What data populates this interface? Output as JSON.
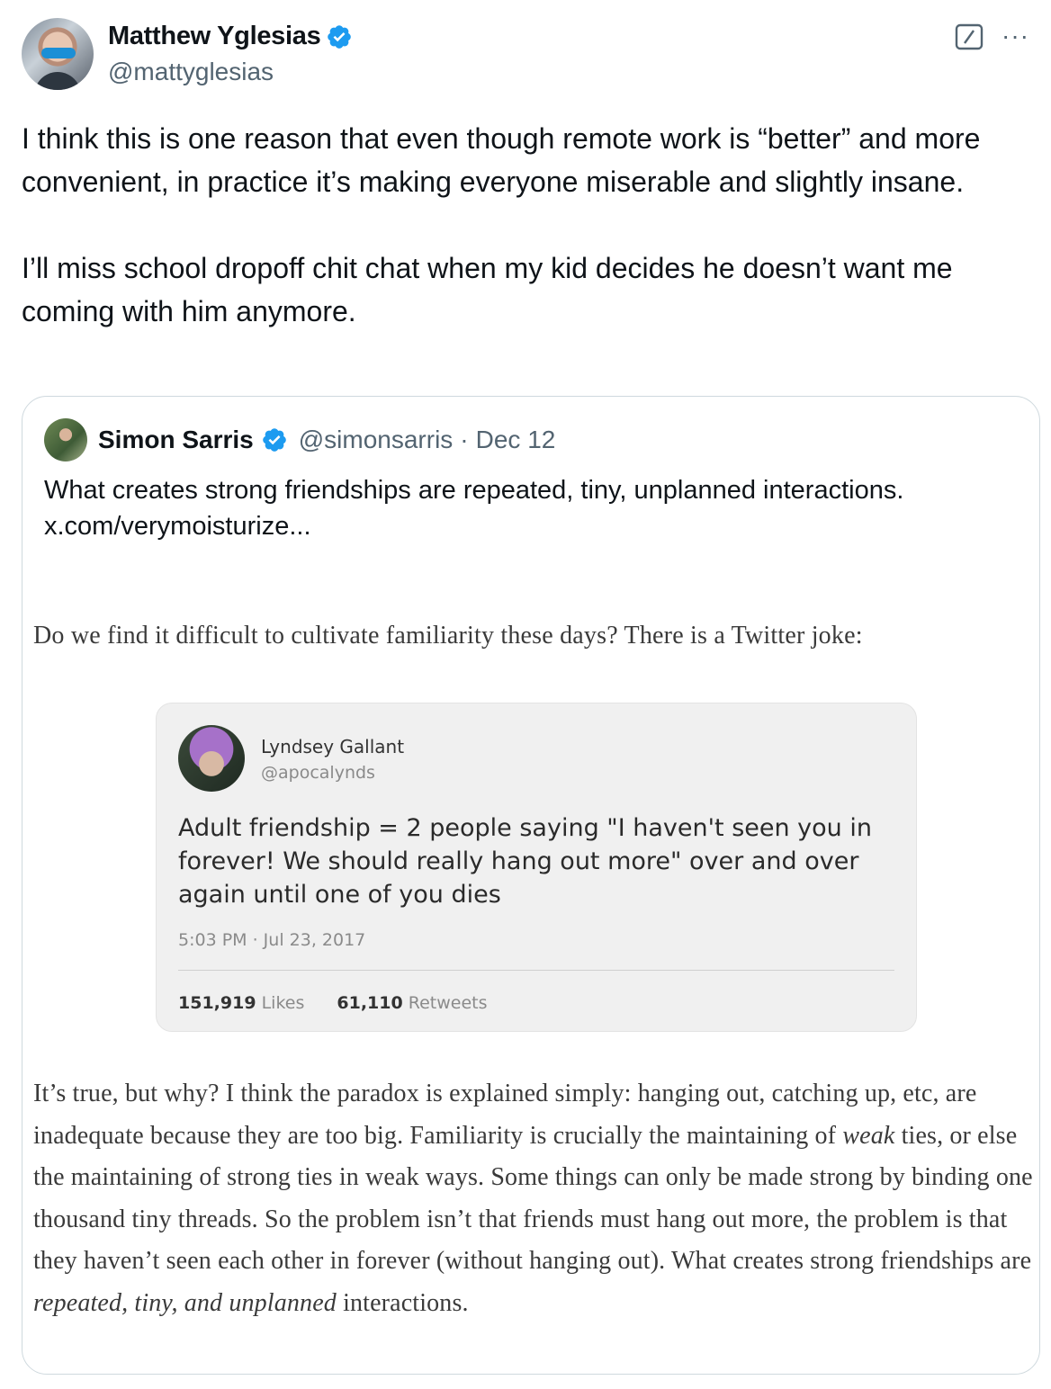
{
  "author": {
    "name": "Matthew Yglesias",
    "handle": "@mattyglesias"
  },
  "tweet": {
    "paragraph1": "I think this is one reason that even though remote work is “better” and more convenient, in practice it’s making everyone miserable and slightly insane.",
    "paragraph2": "I’ll miss school dropoff chit chat when my kid decides he doesn’t want me coming with him anymore."
  },
  "actions": {
    "more": "···"
  },
  "quoted": {
    "name": "Simon Sarris",
    "handle": "@simonsarris",
    "separator": "·",
    "date": "Dec 12",
    "text_line1": "What creates strong friendships are repeated, tiny, unplanned interactions.",
    "text_line2": "x.com/verymoisturize..."
  },
  "article": {
    "intro": "Do we find it difficult to cultivate familiarity these days? There is a Twitter joke:",
    "body_part1": "It’s true, but why? I think the paradox is explained simply: hanging out, catching up, etc, are inadequate because they are too big. Familiarity is crucially the maintaining of ",
    "body_em1": "weak",
    "body_part2": " ties, or else the maintaining of strong ties in weak ways. Some things can only be made strong by binding one thousand tiny threads. So the problem isn’t that friends must hang out more, the problem is that they haven’t seen each other in forever (without hanging out). What creates strong friendships are ",
    "body_em2": "repeated, tiny, and unplanned",
    "body_part3": " interactions."
  },
  "embedded_tweet": {
    "name": "Lyndsey Gallant",
    "handle": "@apocalynds",
    "text": "Adult friendship = 2 people saying \"I haven't seen you in forever! We should really hang out more\" over and over again until one of you dies",
    "time": "5:03 PM · Jul 23, 2017",
    "likes_count": "151,919",
    "likes_label": "Likes",
    "retweets_count": "61,110",
    "retweets_label": "Retweets"
  },
  "colors": {
    "verified_blue": "#1d9bf0",
    "secondary_text": "#536471",
    "border": "#cfd9de"
  }
}
